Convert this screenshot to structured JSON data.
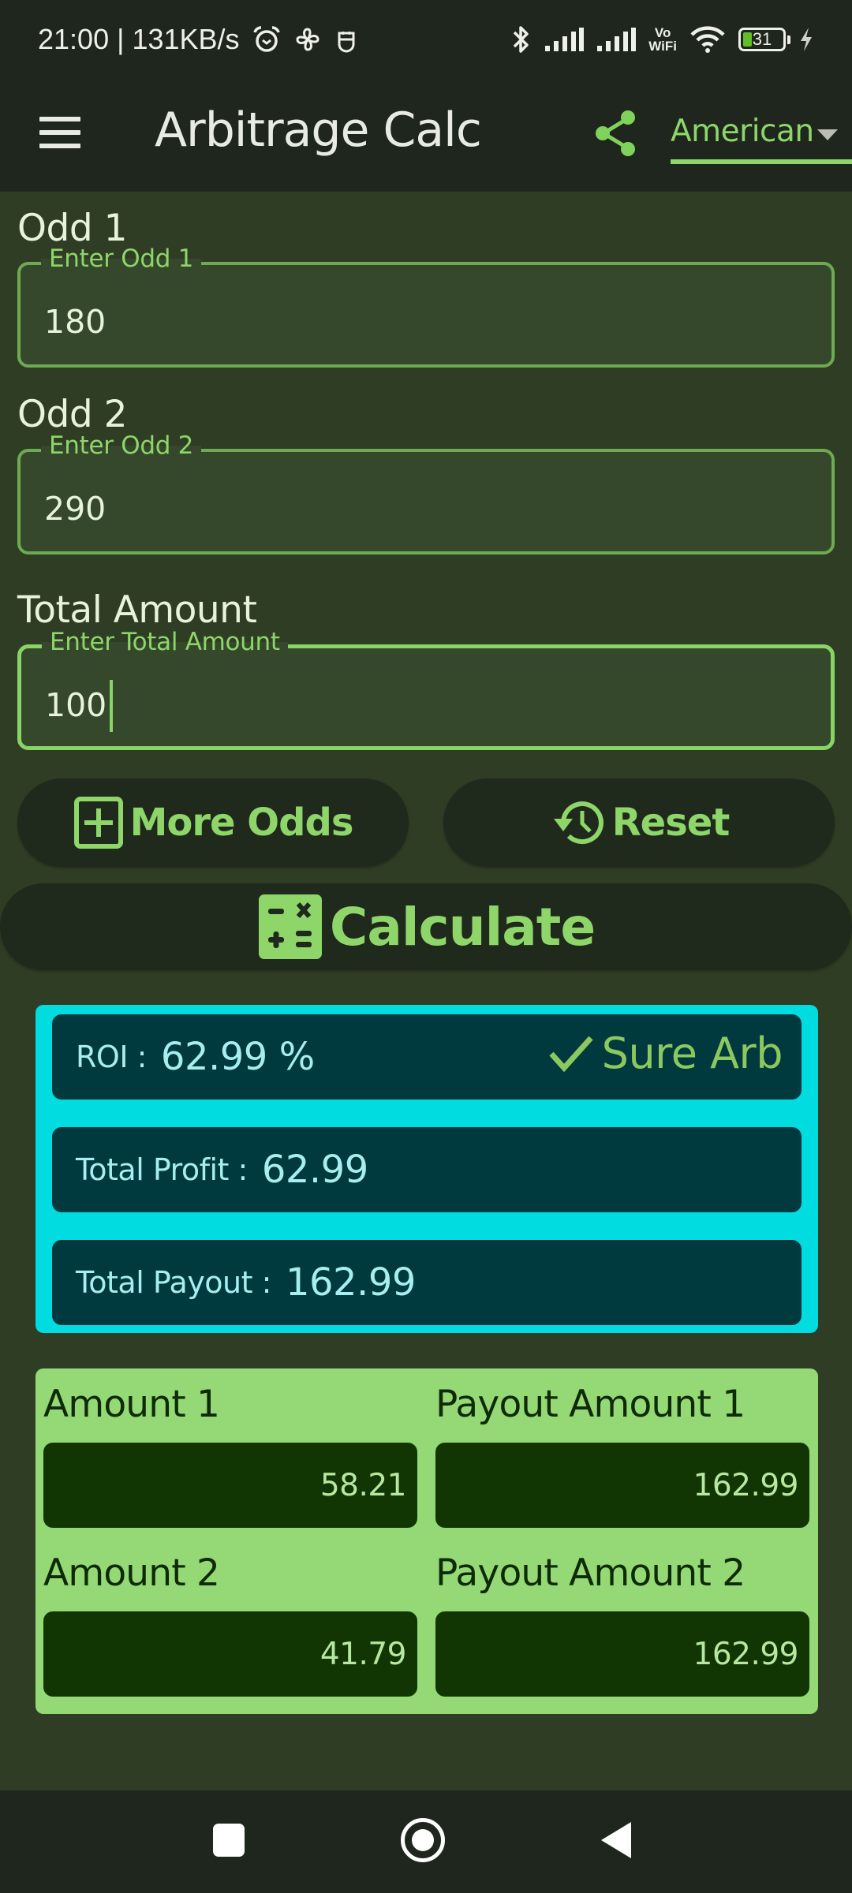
{
  "status_bar": {
    "time_speed": "21:00 | 131KB/s",
    "battery_level": "31",
    "vowifi_top": "Vo",
    "vowifi_bottom": "WiFi"
  },
  "app_bar": {
    "title": "Arbitrage Calc",
    "odds_format": "American"
  },
  "form": {
    "odd1": {
      "label": "Odd 1",
      "hint": "Enter Odd 1",
      "value": "180"
    },
    "odd2": {
      "label": "Odd 2",
      "hint": "Enter Odd 2",
      "value": "290"
    },
    "total": {
      "label": "Total Amount",
      "hint": "Enter Total Amount",
      "value": "100"
    }
  },
  "buttons": {
    "more_odds": "More Odds",
    "reset": "Reset",
    "calculate": "Calculate"
  },
  "results": {
    "roi_label": "ROI :",
    "roi_value": "62.99 %",
    "status": "Sure Arb",
    "profit_label": "Total Profit :",
    "profit_value": "62.99",
    "payout_label": "Total Payout :",
    "payout_value": "162.99"
  },
  "amounts": {
    "amount1_label": "Amount 1",
    "amount1_value": "58.21",
    "payout1_label": "Payout Amount 1",
    "payout1_value": "162.99",
    "amount2_label": "Amount 2",
    "amount2_value": "41.79",
    "payout2_label": "Payout Amount 2",
    "payout2_value": "162.99"
  },
  "colors": {
    "accent": "#8ed66a",
    "results_border": "#00dcdf",
    "results_bg": "#003a3f",
    "amounts_bg": "#95d976",
    "amount_box": "#113603"
  }
}
